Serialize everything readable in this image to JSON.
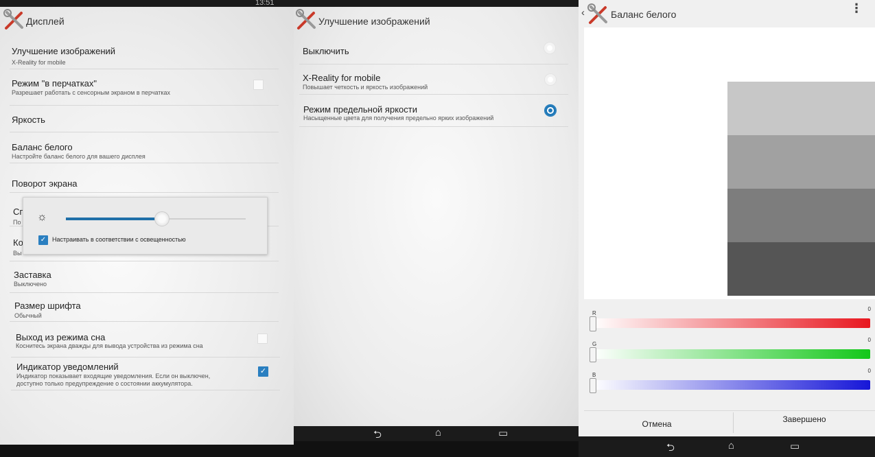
{
  "status_bar": {
    "time": "13:51"
  },
  "panel_display": {
    "title": "Дисплей",
    "items": [
      {
        "title": "Улучшение изображений",
        "subtitle": "X-Reality for mobile"
      },
      {
        "title": "Режим \"в перчатках\"",
        "subtitle": "Разрешает работать с сенсорным экраном в перчатках"
      },
      {
        "title": "Яркость"
      },
      {
        "title": "Баланс белого",
        "subtitle": "Настройте баланс белого для вашего дисплея"
      },
      {
        "title": "Поворот экрана"
      },
      {
        "title": "Сп",
        "subtitle": "По"
      },
      {
        "title": "Ко",
        "subtitle": "Вы"
      },
      {
        "title": "Заставка",
        "subtitle": "Выключено"
      },
      {
        "title": "Размер шрифта",
        "subtitle": "Обычный"
      },
      {
        "title": "Выход из режима сна",
        "subtitle": "Коснитесь экрана дважды для вывода устройства из режима сна"
      },
      {
        "title": "Индикатор уведомлений",
        "subtitle": "Индикатор показывает входящие уведомления. Если он выключен,",
        "subtitle2": "доступно только предупреждение о состоянии аккумулятора."
      }
    ],
    "checks": {
      "gloves": false,
      "wake": false,
      "notify": true
    },
    "brightness_dialog": {
      "auto_label": "Настраивать в соответствии с освещенностью",
      "auto_checked": true,
      "level": 0.53
    }
  },
  "panel_image": {
    "title": "Улучшение изображений",
    "options": [
      {
        "title": "Выключить",
        "subtitle": "",
        "selected": false
      },
      {
        "title": "X-Reality for mobile",
        "subtitle": "Повышает четкость и яркость изображений",
        "selected": false
      },
      {
        "title": "Режим предельной яркости",
        "subtitle": "Насыщенные цвета для получения предельно ярких изображений",
        "selected": true
      }
    ]
  },
  "panel_wb": {
    "title": "Баланс белого",
    "channels": [
      {
        "label": "R",
        "value": "0",
        "color": "#e8171f"
      },
      {
        "label": "G",
        "value": "0",
        "color": "#13c71a"
      },
      {
        "label": "B",
        "value": "0",
        "color": "#1616d8"
      }
    ],
    "swatch_grays": [
      "#c7c7c7",
      "#a1a1a1",
      "#7d7d7d",
      "#555555"
    ],
    "cancel_label": "Отмена",
    "done_label": "Завершено"
  },
  "icons": {
    "settings": "tools-icon",
    "back": "back-arrow-icon",
    "overflow": "overflow-menu-icon",
    "nav": [
      "back-icon",
      "home-icon",
      "recent-apps-icon"
    ]
  }
}
